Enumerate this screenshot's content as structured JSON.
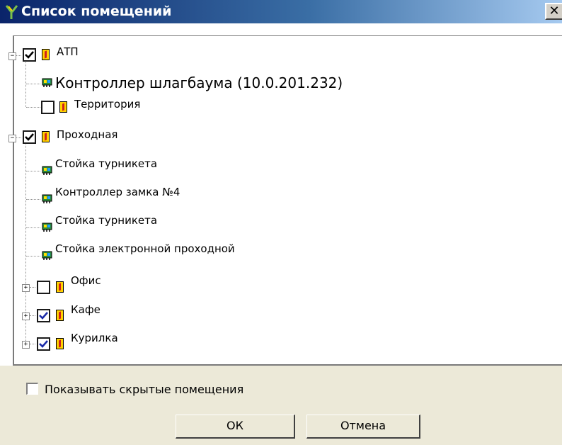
{
  "window": {
    "title": "Список помещений",
    "close_glyph": "✕"
  },
  "tree": {
    "nodes": [
      {
        "label": "АТП",
        "checked": true,
        "expander": "⊟",
        "icon": "door-icon"
      },
      {
        "label": "Контроллер шлагбаума (10.0.201.232)",
        "icon": "device-icon"
      },
      {
        "label": "Территория",
        "checked": false,
        "icon": "door-icon"
      },
      {
        "label": "Проходная",
        "checked": true,
        "expander": "⊟",
        "icon": "door-icon"
      },
      {
        "label": "Стойка турникета",
        "icon": "device-icon"
      },
      {
        "label": "Контроллер замка №4",
        "icon": "device-icon"
      },
      {
        "label": "Стойка турникета",
        "icon": "device-icon"
      },
      {
        "label": "Стойка электронной проходной",
        "icon": "device-icon"
      },
      {
        "label": "Офис",
        "checked": false,
        "expander": "⊞",
        "icon": "door-icon"
      },
      {
        "label": "Кафе",
        "checked": true,
        "expander": "⊞",
        "icon": "door-icon"
      },
      {
        "label": "Курилка",
        "checked": true,
        "expander": "⊞",
        "icon": "door-icon"
      }
    ]
  },
  "footer": {
    "show_hidden_label": "Показывать скрытые помещения",
    "show_hidden_checked": false,
    "ok_label": "ОК",
    "cancel_label": "Отмена"
  },
  "colors": {
    "check_dark": "#000000",
    "check_blue": "#1a2aa8",
    "door_fill": "#ffd200"
  }
}
